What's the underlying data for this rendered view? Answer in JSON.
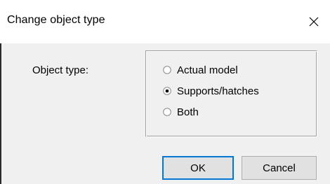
{
  "window": {
    "title": "Change object type",
    "close_icon": "close-icon"
  },
  "form": {
    "object_type_label": "Object type:",
    "options": [
      {
        "label": "Actual model",
        "selected": false
      },
      {
        "label": "Supports/hatches",
        "selected": true
      },
      {
        "label": "Both",
        "selected": false
      }
    ]
  },
  "buttons": {
    "ok_label": "OK",
    "cancel_label": "Cancel"
  },
  "colors": {
    "accent": "#0078d7",
    "dialog_bg": "#f0f0f0",
    "titlebar_bg": "#ffffff"
  }
}
